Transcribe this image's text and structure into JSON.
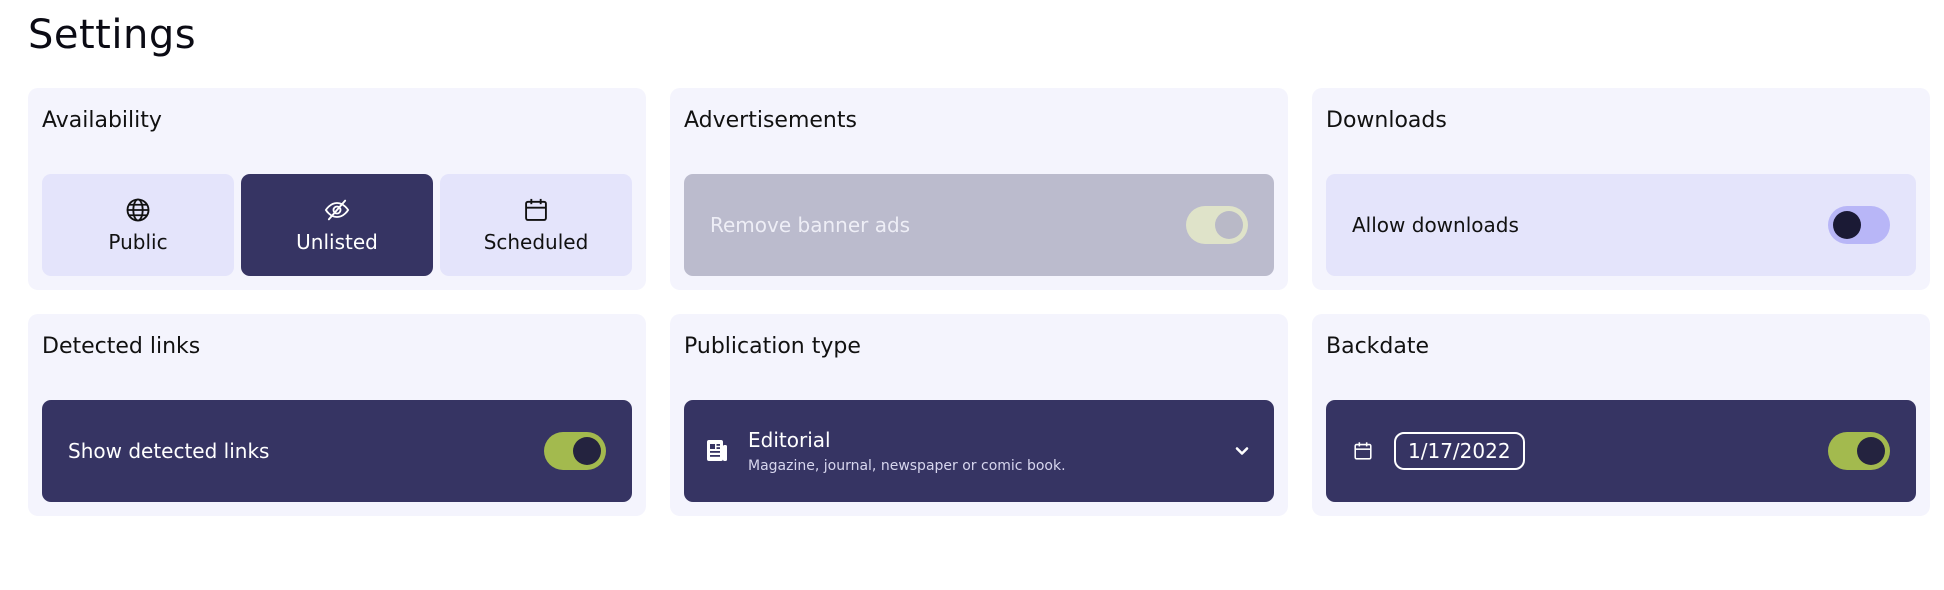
{
  "page": {
    "title": "Settings"
  },
  "availability": {
    "title": "Availability",
    "options": [
      {
        "label": "Public",
        "icon": "globe-icon",
        "selected": false
      },
      {
        "label": "Unlisted",
        "icon": "eye-off-icon",
        "selected": true
      },
      {
        "label": "Scheduled",
        "icon": "calendar-icon",
        "selected": false
      }
    ]
  },
  "advertisements": {
    "title": "Advertisements",
    "toggle_label": "Remove banner ads",
    "enabled": true,
    "disabled": true
  },
  "downloads": {
    "title": "Downloads",
    "toggle_label": "Allow downloads",
    "enabled": false
  },
  "detected_links": {
    "title": "Detected links",
    "toggle_label": "Show detected links",
    "enabled": true
  },
  "publication_type": {
    "title": "Publication type",
    "value": "Editorial",
    "description": "Magazine, journal, newspaper or comic book.",
    "icon": "document-icon"
  },
  "backdate": {
    "title": "Backdate",
    "date": "1/17/2022",
    "enabled": true,
    "icon": "calendar-icon"
  },
  "colors": {
    "dark": "#363463",
    "light": "#e4e4fb",
    "card": "#f4f4fd",
    "toggle_on": "#a3ba4e",
    "toggle_off": "#b8b6f7"
  }
}
